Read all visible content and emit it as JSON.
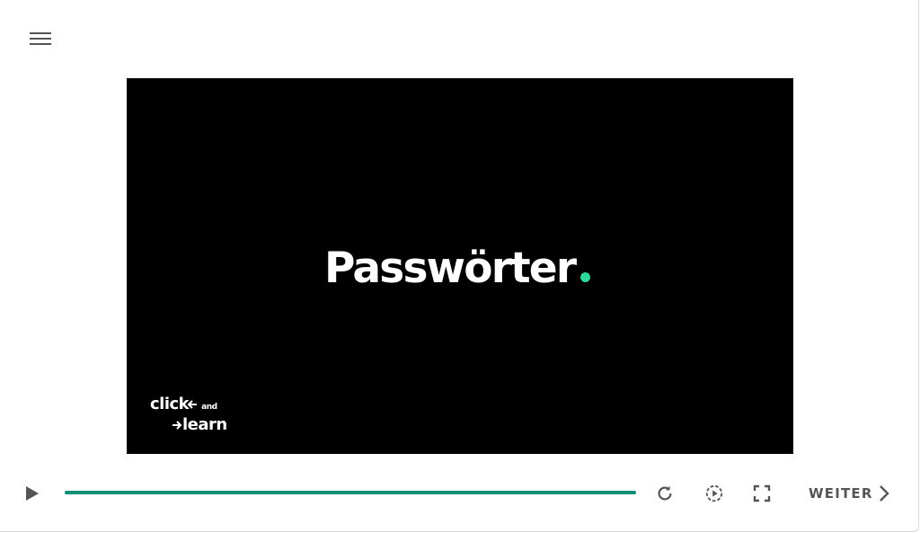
{
  "menu": {
    "icon": "hamburger-menu-icon"
  },
  "video": {
    "title": "Passwörter",
    "title_dot_color": "#2fd89a",
    "logo_line1": "click",
    "logo_and": "and",
    "logo_line2": "learn"
  },
  "controls": {
    "play_icon": "play-icon",
    "progress_fraction": 1.0,
    "progress_color": "#0f8f76",
    "replay_icon": "replay-icon",
    "autoplay_icon": "autoplay-icon",
    "fullscreen_icon": "fullscreen-icon",
    "next_label": "WEITER"
  },
  "colors": {
    "icon": "#555555",
    "video_bg": "#000000"
  }
}
